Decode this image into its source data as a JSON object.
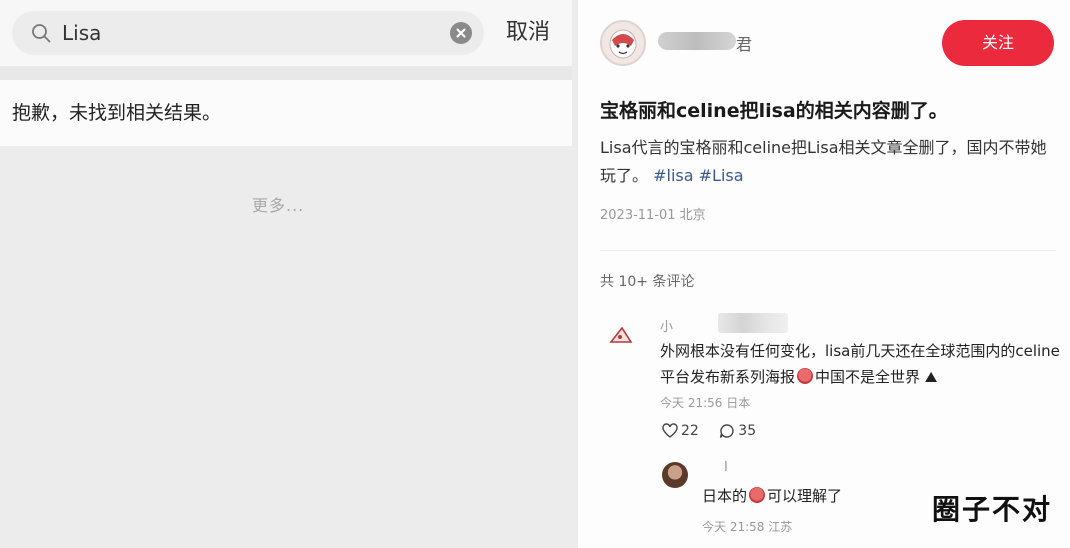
{
  "search": {
    "query": "Lisa",
    "cancel_label": "取消",
    "no_result_text": "抱歉，未找到相关结果。",
    "more_text": "更多..."
  },
  "post": {
    "author_suffix": "君",
    "follow_label": "关注",
    "title": "宝格丽和celine把lisa的相关内容删了。",
    "body_text": "Lisa代言的宝格丽和celine把Lisa相关文章全删了，国内不带她玩了。",
    "tags": [
      "#lisa",
      "#Lisa"
    ],
    "meta": "2023-11-01 北京",
    "comment_count": "共 10+ 条评论"
  },
  "comments": [
    {
      "name": "小",
      "text_a": "外网根本没有任何变化，lisa前几天还在全球范围内的celine平台发布新系列海报",
      "text_b": "中国不是全世界",
      "meta": "今天 21:56 日本",
      "likes": "22",
      "replies": "35"
    },
    {
      "name": "I",
      "text_a": "日本的",
      "text_b": "可以理解了",
      "meta": "今天 21:58 江苏"
    }
  ],
  "watermark": "圈子不对",
  "colors": {
    "follow_button": "#ec2a3d",
    "tag": "#3a5a8c"
  },
  "icons": {
    "search": "search-icon",
    "clear": "clear-icon",
    "like": "heart-icon",
    "reply": "comment-icon"
  }
}
